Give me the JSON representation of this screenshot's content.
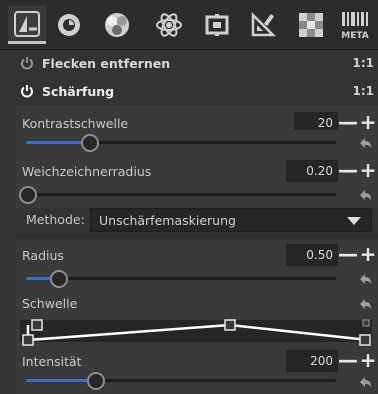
{
  "toolbar": {
    "tools": [
      {
        "name": "detail-tool-icon",
        "active": true
      },
      {
        "name": "color-tool-icon",
        "active": false
      },
      {
        "name": "exposure-tool-icon",
        "active": false
      },
      {
        "name": "advanced-tool-icon",
        "active": false
      },
      {
        "name": "raw-tool-icon",
        "active": false
      },
      {
        "name": "transform-tool-icon",
        "active": false
      },
      {
        "name": "filter-tool-icon",
        "active": false
      },
      {
        "name": "meta-tool-icon",
        "active": false
      }
    ],
    "meta_label": "META"
  },
  "sections": {
    "flecken": {
      "title": "Flecken entfernen",
      "ratio": "1:1"
    },
    "schaerfung": {
      "title": "Schärfung",
      "ratio": "1:1"
    }
  },
  "controls": {
    "kontrastschwelle": {
      "label": "Kontrastschwelle",
      "value": "20",
      "fraction": 0.2
    },
    "weichzeichnerradius": {
      "label": "Weichzeichnerradius",
      "value": "0.20",
      "fraction": 0.0
    },
    "methode": {
      "label": "Methode:",
      "value": "Unschärfemaskierung"
    },
    "radius": {
      "label": "Radius",
      "value": "0.50",
      "fraction": 0.1
    },
    "schwelle": {
      "label": "Schwelle"
    },
    "intensitaet": {
      "label": "Intensität",
      "value": "200",
      "fraction": 0.22
    }
  },
  "buttons": {
    "minus": "—",
    "plus": "+"
  },
  "colors": {
    "accent": "#3a6fc2",
    "panel": "#333333",
    "inner": "#3a3a3a"
  }
}
